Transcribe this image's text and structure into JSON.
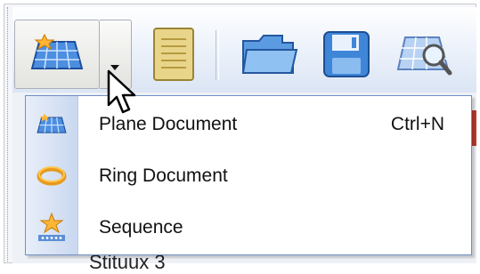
{
  "toolbar": {
    "buttons": [
      {
        "name": "new-plane-document-button",
        "icon": "plane-grid-icon",
        "pressed": true
      },
      {
        "name": "new-document-dropdown-arrow",
        "icon": "chevron-down-icon"
      },
      {
        "name": "notes-button",
        "icon": "notepad-icon"
      },
      {
        "name": "open-button",
        "icon": "folder-open-icon"
      },
      {
        "name": "save-button",
        "icon": "floppy-disk-icon"
      },
      {
        "name": "preview-button",
        "icon": "grid-magnifier-icon"
      }
    ]
  },
  "menu": {
    "items": [
      {
        "label": "Plane Document",
        "shortcut": "Ctrl+N",
        "icon": "plane-grid-icon"
      },
      {
        "label": "Ring Document",
        "shortcut": "",
        "icon": "ring-icon"
      },
      {
        "label": "Sequence",
        "shortcut": "",
        "icon": "sequence-star-icon"
      }
    ]
  },
  "background": {
    "partial_text": "Stituux 3"
  },
  "colors": {
    "menu_border": "#6e8fc6",
    "gutter": "#c9d8ef",
    "toolbar_top": "#ffffff",
    "toolbar_bottom": "#dbe5f4"
  }
}
